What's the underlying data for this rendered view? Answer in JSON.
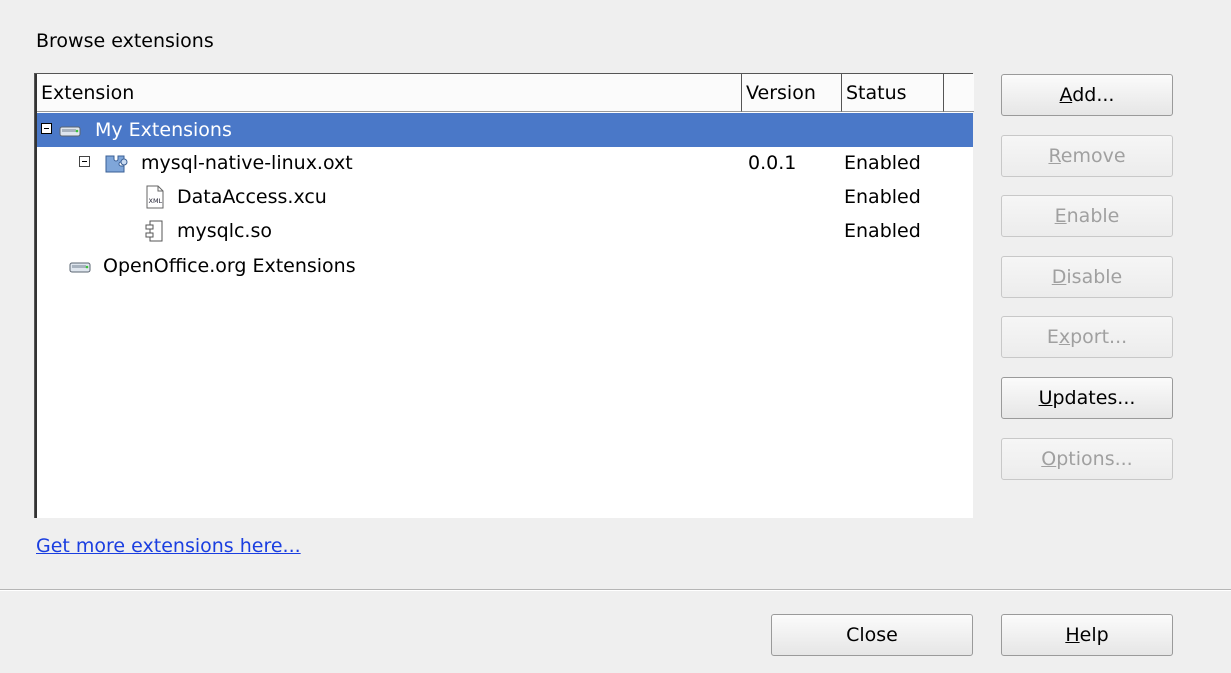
{
  "group_title": "Browse extensions",
  "columns": {
    "extension": "Extension",
    "version": "Version",
    "status": "Status"
  },
  "tree": [
    {
      "name": "My Extensions",
      "version": "",
      "status": "",
      "level": 0,
      "expanded": true,
      "selected": true,
      "icon": "drive-icon"
    },
    {
      "name": "mysql-native-linux.oxt",
      "version": "0.0.1",
      "status": "Enabled",
      "level": 1,
      "expanded": true,
      "selected": false,
      "icon": "puzzle-package-icon"
    },
    {
      "name": "DataAccess.xcu",
      "version": "",
      "status": "Enabled",
      "level": 2,
      "selected": false,
      "icon": "xml-file-icon"
    },
    {
      "name": "mysqlc.so",
      "version": "",
      "status": "Enabled",
      "level": 2,
      "selected": false,
      "icon": "component-icon"
    },
    {
      "name": "OpenOffice.org Extensions",
      "version": "",
      "status": "",
      "level": 0,
      "selected": false,
      "icon": "drive-icon"
    }
  ],
  "buttons": {
    "add": {
      "mnemonic": "A",
      "rest": "dd..."
    },
    "remove": {
      "mnemonic": "R",
      "rest": "emove"
    },
    "enable": {
      "mnemonic": "E",
      "rest": "nable"
    },
    "disable": {
      "mnemonic": "D",
      "rest": "isable"
    },
    "export": {
      "pre": "E",
      "mnemonic": "x",
      "rest": "port..."
    },
    "updates": {
      "mnemonic": "U",
      "rest": "pdates..."
    },
    "options": {
      "mnemonic": "O",
      "rest": "ptions..."
    },
    "close": "Close",
    "help": {
      "mnemonic": "H",
      "rest": "elp"
    }
  },
  "link_text": "Get more extensions here...",
  "colors": {
    "selection": "#4a78c8",
    "link": "#1a3ee0",
    "disabled_text": "#a0a0a0"
  }
}
